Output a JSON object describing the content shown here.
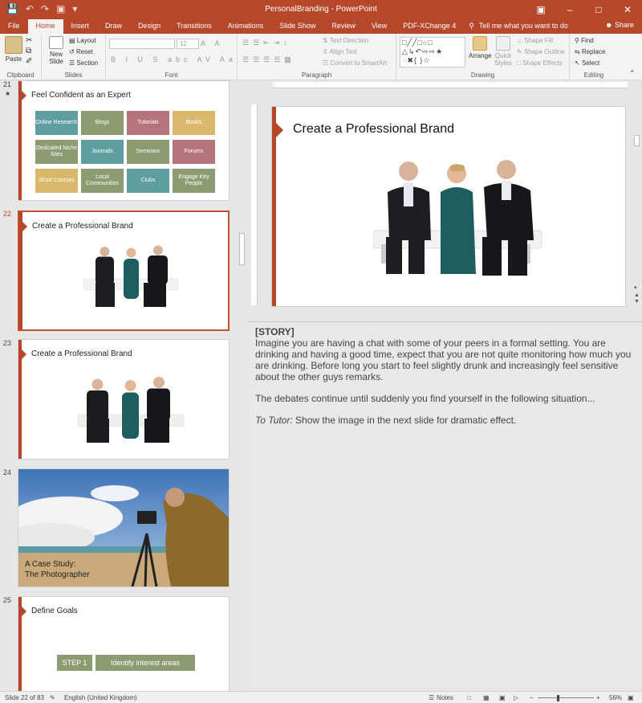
{
  "window": {
    "title": "PersonalBranding  -  PowerPoint",
    "controls": [
      "restore-ribbon-icon",
      "minimize-icon",
      "maximize-icon",
      "close-icon"
    ]
  },
  "quick_access": [
    "save-icon",
    "undo-icon",
    "redo-icon",
    "start-slideshow-icon",
    "customize-icon"
  ],
  "tabs": [
    "File",
    "Home",
    "Insert",
    "Draw",
    "Design",
    "Transitions",
    "Animations",
    "Slide Show",
    "Review",
    "View",
    "PDF-XChange 4"
  ],
  "active_tab": "Home",
  "tell_me": "Tell me what you want to do",
  "share": "Share",
  "ribbon": {
    "clipboard": {
      "label": "Clipboard",
      "paste": "Paste"
    },
    "slides": {
      "label": "Slides",
      "new_slide_line1": "New",
      "new_slide_line2": "Slide",
      "layout": "Layout",
      "reset": "Reset",
      "section": "Section"
    },
    "font": {
      "label": "Font",
      "size": "12"
    },
    "paragraph": {
      "label": "Paragraph",
      "text_direction": "Text Direction",
      "align_text": "Align Text",
      "convert": "Convert to SmartArt"
    },
    "drawing": {
      "label": "Drawing",
      "arrange": "Arrange",
      "quick_styles_line1": "Quick",
      "quick_styles_line2": "Styles",
      "shape_fill": "Shape Fill",
      "shape_outline": "Shape Outline",
      "shape_effects": "Shape Effects"
    },
    "editing": {
      "label": "Editing",
      "find": "Find",
      "replace": "Replace",
      "select": "Select"
    }
  },
  "thumbnails": [
    {
      "num": "21",
      "star": "★",
      "title": "Feel Confident as an Expert",
      "tiles": [
        "Online Research",
        "Blogs",
        "Tutorials",
        "Books",
        "Dedicated Niche Sites",
        "Journals",
        "Seminars",
        "Forums",
        "Short Courses",
        "Local Communities",
        "Clubs",
        "Engage Key People"
      ]
    },
    {
      "num": "22",
      "title": "Create a Professional Brand"
    },
    {
      "num": "23",
      "title": "Create a Professional Brand"
    },
    {
      "num": "24",
      "title_line1": "A Case Study:",
      "title_line2": "The Photographer"
    },
    {
      "num": "25",
      "title": "Define Goals",
      "step": "STEP 1",
      "step_text": "Identify interest areas"
    }
  ],
  "current_slide": {
    "title": "Create a Professional Brand"
  },
  "notes": {
    "tag": "[STORY]",
    "p1": "Imagine you are having a chat with some of your peers in a formal setting. You are drinking and having a good time, expect that you are not quite monitoring how much you are drinking. Before long you start to feel slightly drunk and increasingly feel sensitive about the other guys remarks.",
    "p2": "The debates continue until suddenly you find yourself in the following situation...",
    "tutor_label": "To Tutor:",
    "tutor_text": " Show the image in the next slide for dramatic effect."
  },
  "status": {
    "slide": "Slide 22 of 83",
    "language": "English (United Kingdom)",
    "notes": "Notes",
    "zoom": "56%"
  },
  "colors": {
    "accent": "#b7472a",
    "tile_teal": "#5f9ea0",
    "tile_olive": "#8e9a70",
    "tile_rose": "#b5747c",
    "tile_gold": "#d9b86c"
  }
}
